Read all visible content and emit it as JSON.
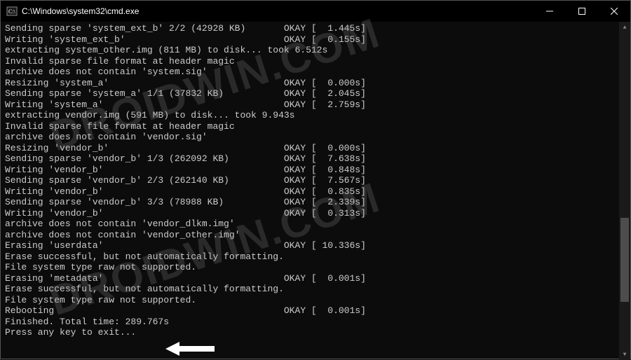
{
  "window": {
    "title": "C:\\Windows\\system32\\cmd.exe"
  },
  "watermark": "DROIDWIN.COM",
  "terminal_lines": [
    "Sending sparse 'system_ext_b' 2/2 (42928 KB)       OKAY [  1.445s]",
    "Writing 'system_ext_b'                             OKAY [  0.155s]",
    "extracting system_other.img (811 MB) to disk... took 6.512s",
    "Invalid sparse file format at header magic",
    "archive does not contain 'system.sig'",
    "Resizing 'system_a'                                OKAY [  0.000s]",
    "Sending sparse 'system_a' 1/1 (37832 KB)           OKAY [  2.045s]",
    "Writing 'system_a'                                 OKAY [  2.759s]",
    "extracting vendor.img (591 MB) to disk... took 9.943s",
    "Invalid sparse file format at header magic",
    "archive does not contain 'vendor.sig'",
    "Resizing 'vendor_b'                                OKAY [  0.000s]",
    "Sending sparse 'vendor_b' 1/3 (262092 KB)          OKAY [  7.638s]",
    "Writing 'vendor_b'                                 OKAY [  0.848s]",
    "Sending sparse 'vendor_b' 2/3 (262140 KB)          OKAY [  7.567s]",
    "Writing 'vendor_b'                                 OKAY [  0.835s]",
    "Sending sparse 'vendor_b' 3/3 (78988 KB)           OKAY [  2.339s]",
    "Writing 'vendor_b'                                 OKAY [  0.313s]",
    "archive does not contain 'vendor_dlkm.img'",
    "archive does not contain 'vendor_other.img'",
    "Erasing 'userdata'                                 OKAY [ 10.336s]",
    "Erase successful, but not automatically formatting.",
    "File system type raw not supported.",
    "Erasing 'metadata'                                 OKAY [  0.001s]",
    "Erase successful, but not automatically formatting.",
    "File system type raw not supported.",
    "Rebooting                                          OKAY [  0.001s]",
    "Finished. Total time: 289.767s",
    "Press any key to exit..."
  ]
}
